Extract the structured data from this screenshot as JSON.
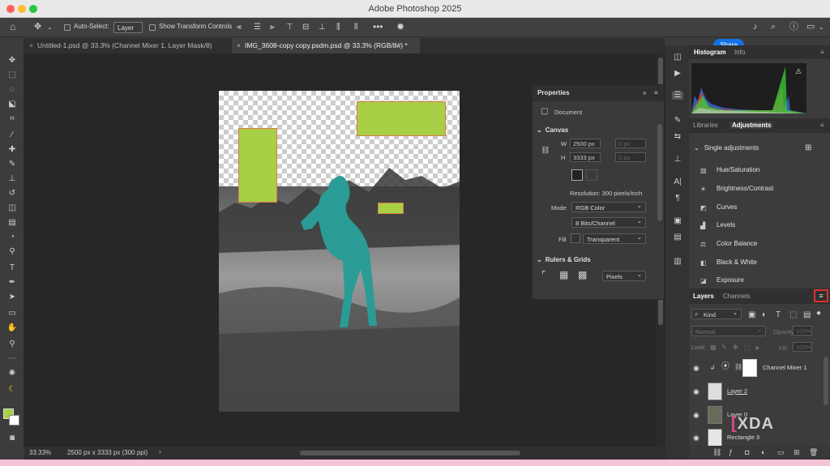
{
  "app": {
    "title": "Adobe Photoshop 2025",
    "share_label": "Share"
  },
  "options_bar": {
    "auto_select_label": "Auto-Select:",
    "auto_select_value": "Layer",
    "show_transform_label": "Show Transform Controls"
  },
  "doc_tabs": [
    {
      "label": "Untitled-1.psd @ 33.3% (Channel Mixer 1, Layer Mask/8)"
    },
    {
      "label": "IMG_3608-copy copy.psdm.psd @ 33.3% (RGB/8#) *"
    }
  ],
  "status_bar": {
    "zoom": "33.33%",
    "doc_size": "2500 px x 3333 px (300 ppi)"
  },
  "properties": {
    "title": "Properties",
    "doc_label": "Document",
    "canvas_section": "Canvas",
    "w_label": "W",
    "w_value": "2500 px",
    "x_placeholder": "0 px",
    "h_label": "H",
    "h_value": "3333 px",
    "y_placeholder": "0 px",
    "resolution": "Resolution: 300 pixels/inch",
    "mode_label": "Mode",
    "mode_value": "RGB Color",
    "bits_value": "8 Bits/Channel",
    "fill_label": "Fill",
    "fill_value": "Transparent",
    "rulers_section": "Rulers & Grids",
    "units_value": "Pixels"
  },
  "histogram_tabs": [
    "Histogram",
    "Info"
  ],
  "adjust_tabs": [
    "Libraries",
    "Adjustments"
  ],
  "adjustments": {
    "section": "Single adjustments",
    "items": [
      {
        "label": "Hue/Saturation",
        "icon": "hue-saturation-icon"
      },
      {
        "label": "Brightness/Contrast",
        "icon": "brightness-contrast-icon"
      },
      {
        "label": "Curves",
        "icon": "curves-icon"
      },
      {
        "label": "Levels",
        "icon": "levels-icon"
      },
      {
        "label": "Color Balance",
        "icon": "color-balance-icon"
      },
      {
        "label": "Black & White",
        "icon": "black-white-icon"
      },
      {
        "label": "Exposure",
        "icon": "exposure-icon"
      }
    ]
  },
  "layers_tabs": [
    "Layers",
    "Channels"
  ],
  "layers": {
    "filter_label": "Kind",
    "blend_mode": "Normal",
    "opacity_label": "Opacity:",
    "opacity_value": "100%",
    "lock_label": "Lock:",
    "fill_label": "Fill:",
    "fill_value": "100%",
    "items": [
      {
        "name": "Channel Mixer 1",
        "visible": true
      },
      {
        "name": "Layer 2",
        "visible": true
      },
      {
        "name": "Layer 0",
        "visible": true
      },
      {
        "name": "Rectangle 3",
        "visible": true
      }
    ]
  },
  "watermark": "XDA",
  "colors": {
    "accent": "#1473e6",
    "shape_fill": "#a8cf45",
    "highlight": "#e03030"
  }
}
